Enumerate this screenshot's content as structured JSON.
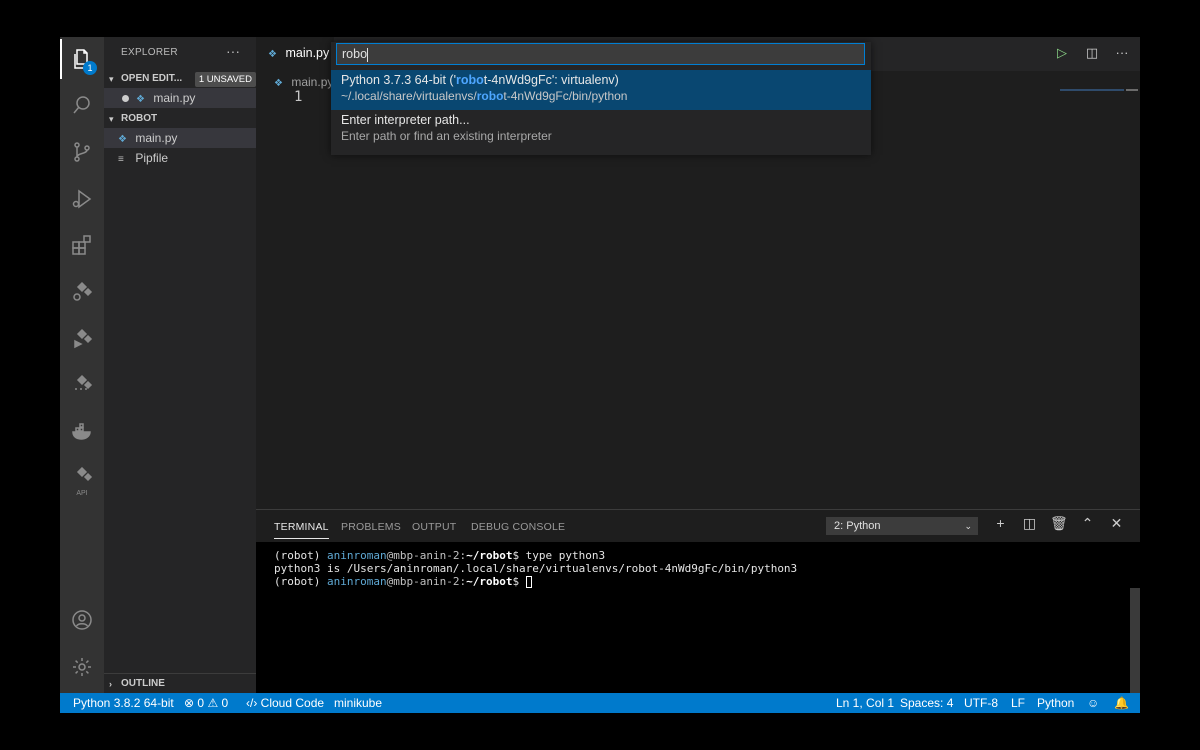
{
  "explorer": {
    "title": "EXPLORER",
    "more": "···",
    "open_editors": {
      "label": "OPEN EDIT...",
      "badge": "1 UNSAVED",
      "items": [
        "main.py"
      ]
    },
    "folder": {
      "label": "ROBOT",
      "items": [
        "main.py",
        "Pipfile"
      ]
    },
    "outline": "OUTLINE"
  },
  "activity": {
    "explorer_badge": "1",
    "api_label": "API"
  },
  "editor": {
    "tab_label": "main.py",
    "breadcrumb": "main.py",
    "line_number": "1"
  },
  "quickpick": {
    "input_value": "robo",
    "items": [
      {
        "label_prefix": "Python 3.7.3 64-bit ('",
        "label_highlight": "robo",
        "label_suffix": "t-4nWd9gFc': virtualenv)",
        "detail_prefix": "~/.local/share/virtualenvs/",
        "detail_highlight": "robo",
        "detail_suffix": "t-4nWd9gFc/bin/python"
      },
      {
        "label": "Enter interpreter path...",
        "detail": "Enter path or find an existing interpreter"
      }
    ]
  },
  "panel": {
    "tabs": [
      "TERMINAL",
      "PROBLEMS",
      "OUTPUT",
      "DEBUG CONSOLE"
    ],
    "terminal_select": "2: Python",
    "lines": [
      {
        "env": "(robot) ",
        "user": "aninroman",
        "host": "@mbp-anin-2:",
        "path": "~/robot",
        "cmd": "$ type python3"
      },
      {
        "text": "python3 is /Users/aninroman/.local/share/virtualenvs/robot-4nWd9gFc/bin/python3"
      },
      {
        "env": "(robot) ",
        "user": "aninroman",
        "host": "@mbp-anin-2:",
        "path": "~/robot",
        "cmd": "$ "
      }
    ]
  },
  "statusbar": {
    "interpreter": "Python 3.8.2 64-bit",
    "errors": "0",
    "warnings": "0",
    "cloud_code": "Cloud Code",
    "minikube": "minikube",
    "position": "Ln 1, Col 1",
    "spaces": "Spaces: 4",
    "encoding": "UTF-8",
    "eol": "LF",
    "language": "Python"
  },
  "colors": {
    "accent": "#007acc",
    "selection": "#094771",
    "highlight": "#4ea6ff"
  }
}
